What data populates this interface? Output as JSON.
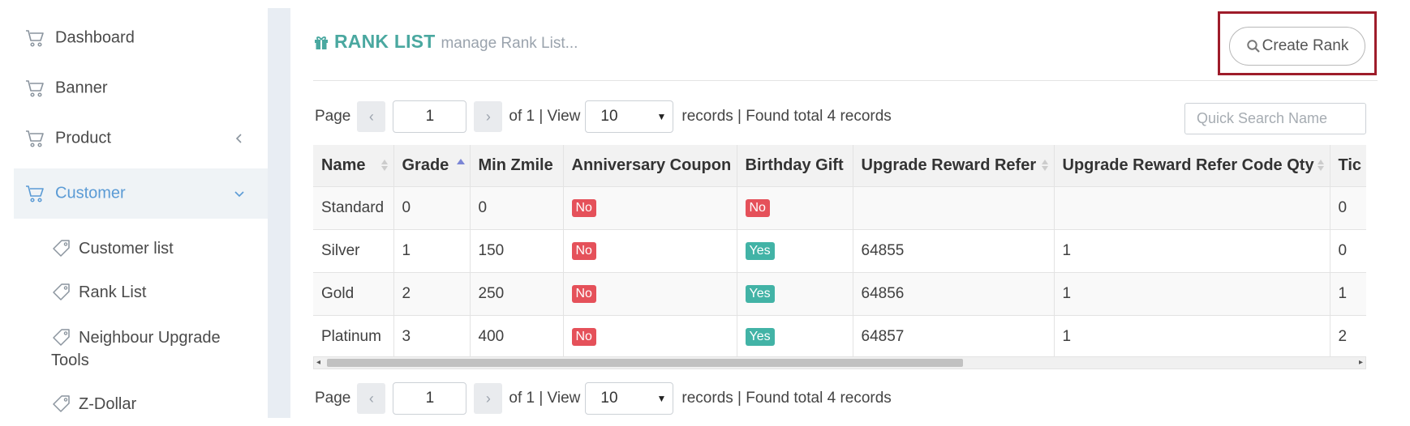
{
  "sidebar": {
    "items": [
      {
        "label": "Dashboard"
      },
      {
        "label": "Banner"
      },
      {
        "label": "Product"
      },
      {
        "label": "Customer"
      }
    ],
    "sub_items": [
      {
        "label": "Customer list"
      },
      {
        "label": "Rank List"
      },
      {
        "label_line1": "Neighbour Upgrade",
        "label_line2": "Tools"
      },
      {
        "label": "Z-Dollar"
      }
    ]
  },
  "header": {
    "title": "RANK LIST",
    "subtitle": "manage Rank List..."
  },
  "toolbar": {
    "create_label": "Create Rank"
  },
  "search": {
    "placeholder": "Quick Search Name"
  },
  "pager": {
    "page_label": "Page",
    "page_value": "1",
    "of_text": "of 1 | View",
    "view_value": "10",
    "records_text": "records | Found total 4 records",
    "prev": "‹",
    "next": "›"
  },
  "table": {
    "columns": [
      "Name",
      "Grade",
      "Min Zmile",
      "Anniversary Coupon",
      "Birthday Gift",
      "Upgrade Reward Refer",
      "Upgrade Reward Refer Code Qty",
      "Tic"
    ],
    "rows": [
      {
        "name": "Standard",
        "grade": "0",
        "min_zmile": "0",
        "anniversary": "No",
        "birthday": "No",
        "refer": "",
        "refer_qty": "",
        "tic": "0"
      },
      {
        "name": "Silver",
        "grade": "1",
        "min_zmile": "150",
        "anniversary": "No",
        "birthday": "Yes",
        "refer": "64855",
        "refer_qty": "1",
        "tic": "0"
      },
      {
        "name": "Gold",
        "grade": "2",
        "min_zmile": "250",
        "anniversary": "No",
        "birthday": "Yes",
        "refer": "64856",
        "refer_qty": "1",
        "tic": "1"
      },
      {
        "name": "Platinum",
        "grade": "3",
        "min_zmile": "400",
        "anniversary": "No",
        "birthday": "Yes",
        "refer": "64857",
        "refer_qty": "1",
        "tic": "2"
      }
    ]
  },
  "colors": {
    "accent_teal": "#4aa8a0",
    "active_blue": "#5b9bd5",
    "badge_no": "#e5515a",
    "badge_yes": "#42b3a6",
    "highlight_border": "#9e1c2a"
  },
  "icons": {
    "nav": "cart-icon",
    "sub": "tag-icon",
    "title": "gift-icon",
    "create": "search-icon"
  }
}
